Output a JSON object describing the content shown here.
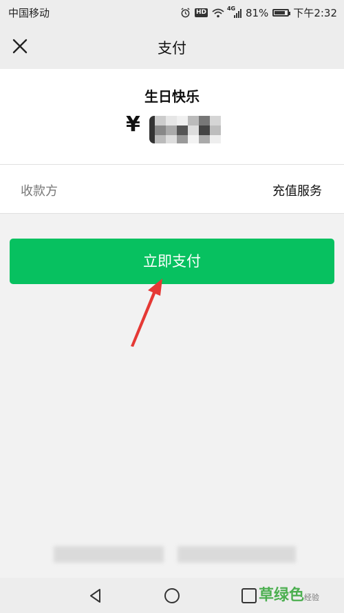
{
  "status_bar": {
    "carrier": "中国移动",
    "hd": "HD",
    "network": "4G",
    "battery_percent": "81%",
    "battery_level": 0.81,
    "time": "下午2:32",
    "icons": [
      "alarm-icon",
      "hd-icon",
      "wifi-icon",
      "signal-icon",
      "battery-icon"
    ]
  },
  "nav": {
    "title": "支付",
    "close_icon": "close-icon"
  },
  "payment": {
    "product_name": "生日快乐",
    "currency": "¥",
    "amount": ""
  },
  "payee": {
    "label": "收款方",
    "value": "充值服务"
  },
  "pay_button": {
    "label": "立即支付",
    "color": "#07c160"
  },
  "annotation": {
    "arrow_color": "#e53935"
  },
  "system_nav": {
    "icons": [
      "back-icon",
      "home-icon",
      "recents-icon"
    ]
  },
  "watermark": {
    "text": "草绿色",
    "suffix": "经验"
  }
}
